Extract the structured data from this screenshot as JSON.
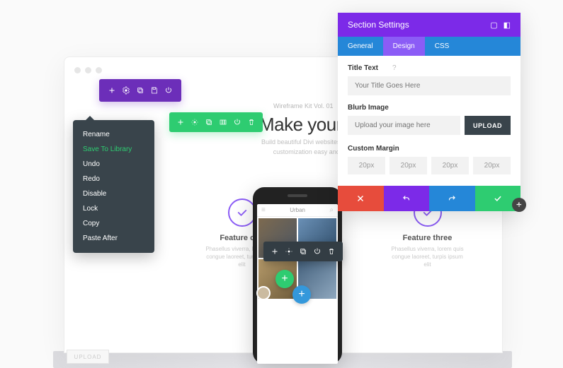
{
  "settings": {
    "title": "Section Settings",
    "tabs": [
      "General",
      "Design",
      "CSS"
    ],
    "active_tab_index": 1,
    "title_text": {
      "label": "Title Text",
      "help": "?",
      "placeholder": "Your Title Goes Here"
    },
    "blurb_image": {
      "label": "Blurb Image",
      "placeholder": "Upload your image here",
      "button": "UPLOAD"
    },
    "custom_margin": {
      "label": "Custom Margin",
      "values": [
        "20px",
        "20px",
        "20px",
        "20px"
      ]
    }
  },
  "context_menu": {
    "items": [
      "Rename",
      "Save To Library",
      "Undo",
      "Redo",
      "Disable",
      "Lock",
      "Copy",
      "Paste After"
    ],
    "active_index": 1
  },
  "page": {
    "wireframe_label": "Wireframe Kit Vol. 01",
    "headline": "Make your ideas a re",
    "subcopy": "Build beautiful Divi websites thanks to a modular content\ncustomization easy and enjoyable. Get your cop",
    "phone_search": "Urban"
  },
  "features": {
    "one": {
      "title": "Feature one",
      "copy": "Phasellus viverra, lorem quis congue laoreet, turpis ipsum elit"
    },
    "three": {
      "title": "Feature three",
      "copy": "Phasellus viverra, lorem quis congue laoreet, turpis ipsum elit"
    }
  },
  "ghost": {
    "upload": "UPLOAD"
  }
}
